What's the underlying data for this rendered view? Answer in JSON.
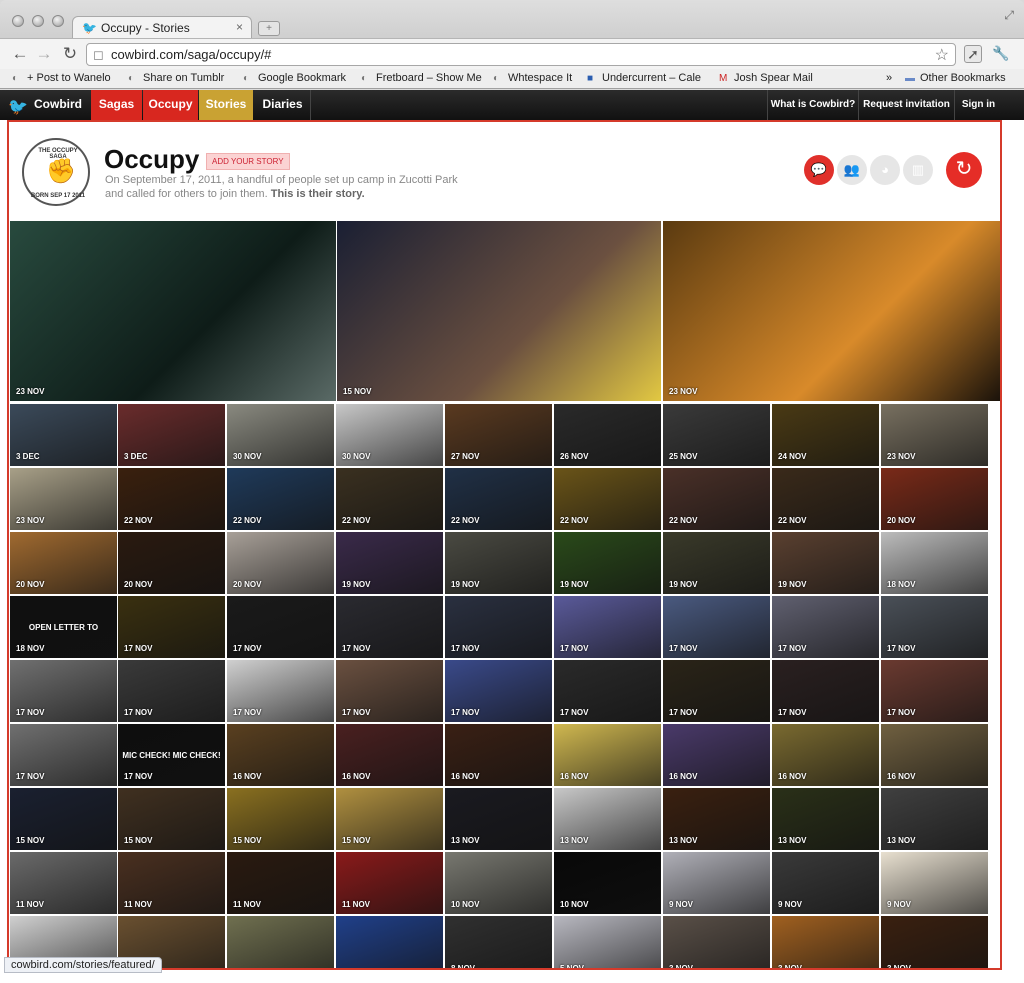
{
  "browser": {
    "tab_title": "Occupy - Stories",
    "url": "cowbird.com/saga/occupy/#",
    "bookmarks": [
      "+ Post to Wanelo",
      "Share on Tumblr",
      "Google Bookmark",
      "Fretboard – Show Me",
      "Whtespace It",
      "Undercurrent – Cale",
      "Josh Spear Mail"
    ],
    "other_bookmarks": "Other Bookmarks",
    "status_url": "cowbird.com/stories/featured/"
  },
  "sitenav": {
    "brand": "Cowbird",
    "items": [
      "Sagas",
      "Occupy",
      "Stories",
      "Diaries"
    ],
    "right": [
      "What is Cowbird?",
      "Request invitation",
      "Sign in"
    ],
    "colors": {
      "sagas": "#d8271f",
      "occupy": "#d8271f",
      "stories": "#c9a233",
      "bar": "#1a1a1a"
    }
  },
  "saga": {
    "title": "Occupy",
    "add_story": "ADD YOUR STORY",
    "description": "On September 17, 2011, a handful of people set up camp in Zucotti Park and called for others to join them.",
    "description_bold": "This is their story.",
    "seal_text": "THE OCCUPY SAGA",
    "seal_subtext": "BORN SEP 17 2011",
    "icons": [
      "speech-bubble-icon",
      "people-icon",
      "globe-icon",
      "chart-icon"
    ],
    "accent": "#e52d27"
  },
  "featured": [
    {
      "date": "23 NOV",
      "colors": [
        "#284a3e",
        "#0e1c18",
        "#5a6a66"
      ]
    },
    {
      "date": "15 NOV",
      "colors": [
        "#1a1f33",
        "#6b5040",
        "#e2c842"
      ]
    },
    {
      "date": "23 NOV",
      "colors": [
        "#5a3a10",
        "#d88a2a",
        "#1a120a"
      ]
    }
  ],
  "grid": [
    [
      "3 DEC",
      "3 DEC",
      "30 NOV",
      "30 NOV",
      "27 NOV",
      "26 NOV",
      "25 NOV",
      "24 NOV",
      "23 NOV"
    ],
    [
      "23 NOV",
      "22 NOV",
      "22 NOV",
      "22 NOV",
      "22 NOV",
      "22 NOV",
      "22 NOV",
      "22 NOV",
      "20 NOV"
    ],
    [
      "20 NOV",
      "20 NOV",
      "20 NOV",
      "19 NOV",
      "19 NOV",
      "19 NOV",
      "19 NOV",
      "19 NOV",
      "18 NOV"
    ],
    [
      "18 NOV",
      "17 NOV",
      "17 NOV",
      "17 NOV",
      "17 NOV",
      "17 NOV",
      "17 NOV",
      "17 NOV",
      "17 NOV"
    ],
    [
      "17 NOV",
      "17 NOV",
      "17 NOV",
      "17 NOV",
      "17 NOV",
      "17 NOV",
      "17 NOV",
      "17 NOV",
      "17 NOV"
    ],
    [
      "17 NOV",
      "17 NOV",
      "16 NOV",
      "16 NOV",
      "16 NOV",
      "16 NOV",
      "16 NOV",
      "16 NOV",
      "16 NOV"
    ],
    [
      "15 NOV",
      "15 NOV",
      "15 NOV",
      "15 NOV",
      "13 NOV",
      "13 NOV",
      "13 NOV",
      "13 NOV",
      "13 NOV"
    ],
    [
      "11 NOV",
      "11 NOV",
      "11 NOV",
      "11 NOV",
      "10 NOV",
      "10 NOV",
      "9 NOV",
      "9 NOV",
      "9 NOV"
    ],
    [
      "",
      "",
      "",
      "",
      "8 NOV",
      "5 NOV",
      "3 NOV",
      "3 NOV",
      "3 NOV"
    ]
  ],
  "grid_captions": {
    "3-0": "OPEN LETTER TO",
    "5-1": "MIC CHECK! MIC CHECK!"
  },
  "grid_colors": [
    [
      "#3b4a5a",
      "#6a2c2c",
      "#8a8a80",
      "#c8c8c8",
      "#5a3a20",
      "#2a2a2a",
      "#3a3a3a",
      "#4a3a14",
      "#787060"
    ],
    [
      "#a8a088",
      "#3a200e",
      "#1f3a5a",
      "#3a3020",
      "#203046",
      "#6a5418",
      "#4a3028",
      "#3a2a1a",
      "#7a2a18"
    ],
    [
      "#a06a30",
      "#2a1a10",
      "#a8a098",
      "#3a2a4a",
      "#4a4a42",
      "#2a4a1a",
      "#3a3a2a",
      "#5a4030",
      "#bcbcbc"
    ],
    [
      "#101010",
      "#3a3010",
      "#1a1a1a",
      "#2a2a30",
      "#2a3040",
      "#5a5a9a",
      "#4a5a80",
      "#606070",
      "#4a5058"
    ],
    [
      "#707070",
      "#3a3a3a",
      "#d0d0d0",
      "#6a5040",
      "#3a4a8a",
      "#2a2a2a",
      "#2a2418",
      "#2a2020",
      "#6a3a30"
    ],
    [
      "#707070",
      "#0e0e0e",
      "#5a4020",
      "#4a2020",
      "#3a2014",
      "#d0b850",
      "#4a3a6a",
      "#7a6a30",
      "#706040"
    ],
    [
      "#1a2030",
      "#403020",
      "#8a7020",
      "#b09040",
      "#1a1a20",
      "#c8c8c8",
      "#3a2010",
      "#2a3018",
      "#404040"
    ],
    [
      "#6a6a6a",
      "#4a3020",
      "#2a1a10",
      "#8a1a1a",
      "#787870",
      "#080808",
      "#b0b0b8",
      "#3a3a3a",
      "#e8e0d0"
    ],
    [
      "#d0d0d0",
      "#6a5030",
      "#707050",
      "#20408a",
      "#303030",
      "#b8b8c0",
      "#5a5048",
      "#a06020",
      "#3a2010"
    ]
  ]
}
